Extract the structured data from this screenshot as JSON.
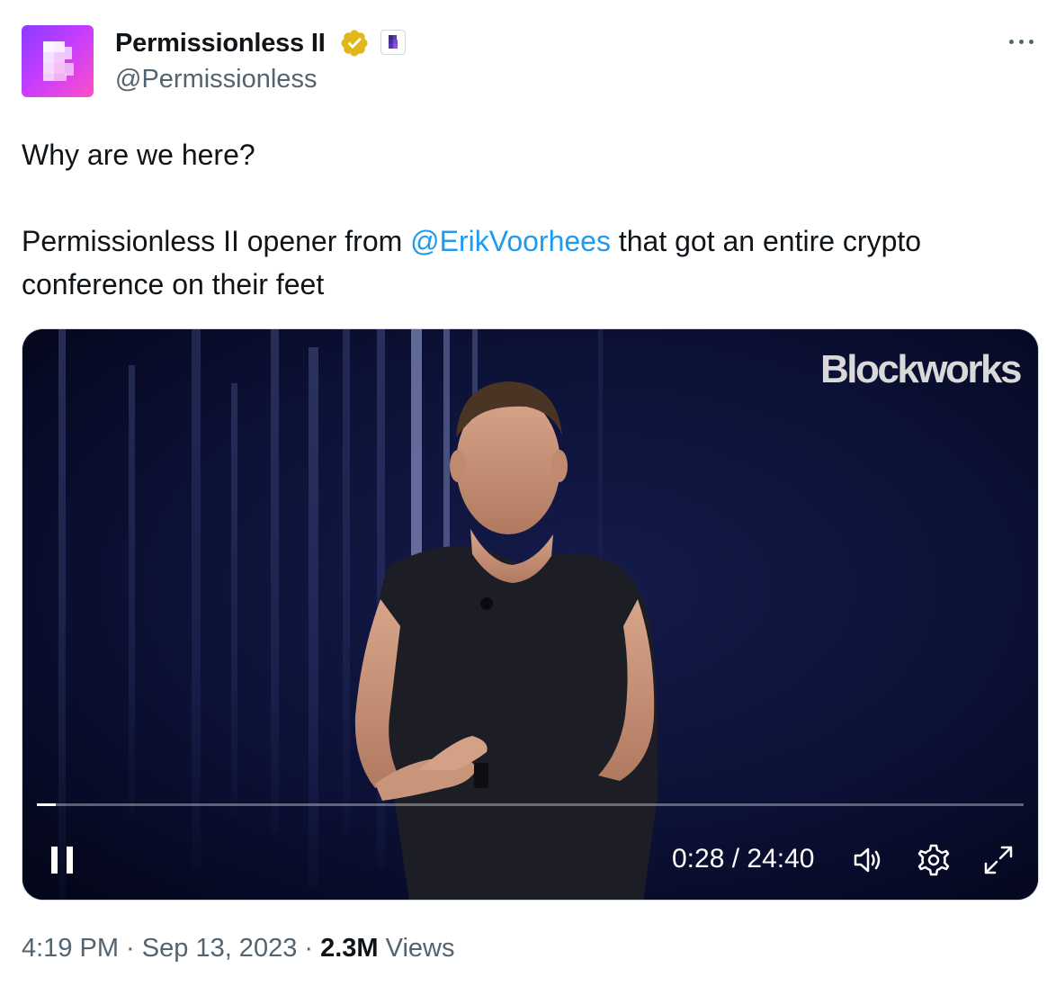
{
  "author": {
    "display_name": "Permissionless II",
    "handle": "@Permissionless",
    "verified_badge_color": "#e2b719",
    "avatar_colors": [
      "#8a3cff",
      "#ff4fc8"
    ]
  },
  "tweet": {
    "line1": "Why are we here?",
    "line2_prefix": "Permissionless II opener from ",
    "mention": "@ErikVoorhees",
    "line2_suffix": " that got an entire crypto conference on their feet",
    "link_color": "#1d9bf0"
  },
  "video": {
    "watermark": "Blockworks",
    "current_time": "0:28",
    "separator": " / ",
    "duration": "24:40",
    "progress_fraction": 0.019,
    "icons": [
      "pause-icon",
      "volume-icon",
      "settings-icon",
      "fullscreen-icon"
    ]
  },
  "meta": {
    "time": "4:19 PM",
    "dot1": " · ",
    "date": "Sep 13, 2023",
    "dot2": " · ",
    "views_count": "2.3M",
    "views_label": " Views"
  },
  "more_icon": "more-options-icon"
}
